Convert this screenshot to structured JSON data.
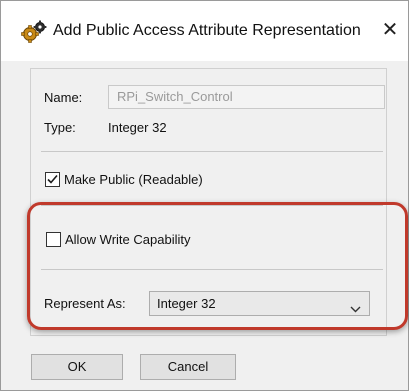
{
  "dialog": {
    "title": "Add Public Access Attribute Representation",
    "close_glyph": "✕"
  },
  "fields": {
    "name_label": "Name:",
    "name_value": "RPi_Switch_Control",
    "type_label": "Type:",
    "type_value": "Integer 32"
  },
  "options": {
    "make_public_label": "Make Public (Readable)",
    "make_public_checked": true,
    "allow_write_label": "Allow Write Capability",
    "allow_write_checked": false
  },
  "represent": {
    "label": "Represent As:",
    "selected": "Integer 32"
  },
  "buttons": {
    "ok": "OK",
    "cancel": "Cancel"
  },
  "colors": {
    "highlight": "#c0392b",
    "checkbox_check": "#1a1a1a"
  },
  "icons": {
    "title": "gears-icon",
    "dropdown": "chevron-down-icon"
  }
}
